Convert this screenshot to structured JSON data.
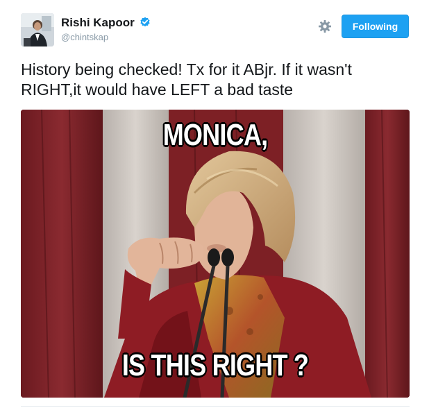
{
  "user": {
    "display_name": "Rishi Kapoor",
    "handle": "@chintskap",
    "verified": true,
    "verified_color": "#1da1f2"
  },
  "actions": {
    "settings_icon": "gear-icon",
    "follow_label": "Following",
    "follow_color": "#1da1f2"
  },
  "tweet": {
    "text": "History being checked! Tx for it ABjr. If it wasn't RIGHT,it would have LEFT a bad taste"
  },
  "media": {
    "caption_top": "MONICA,",
    "caption_bottom": "IS THIS RIGHT ?"
  }
}
